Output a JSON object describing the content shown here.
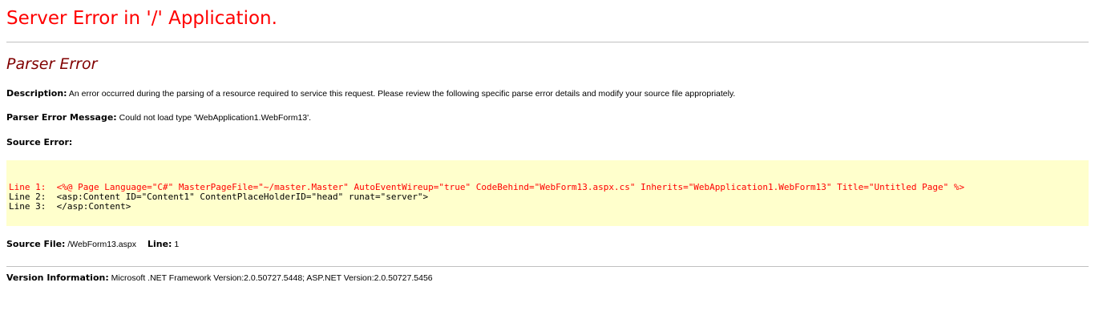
{
  "page": {
    "title": "Server Error in '/' Application.",
    "error_type": "Parser Error"
  },
  "description": {
    "label": "Description:",
    "text": "An error occurred during the parsing of a resource required to service this request. Please review the following specific parse error details and modify your source file appropriately."
  },
  "parser_error_message": {
    "label": "Parser Error Message:",
    "text": "Could not load type 'WebApplication1.WebForm13'."
  },
  "source_error": {
    "label": "Source Error:",
    "lines": [
      {
        "text": "Line 1:  <%@ Page Language=\"C#\" MasterPageFile=\"~/master.Master\" AutoEventWireup=\"true\" CodeBehind=\"WebForm13.aspx.cs\" Inherits=\"WebApplication1.WebForm13\" Title=\"Untitled Page\" %>",
        "highlight": true
      },
      {
        "text": "Line 2:  <asp:Content ID=\"Content1\" ContentPlaceHolderID=\"head\" runat=\"server\">",
        "highlight": false
      },
      {
        "text": "Line 3:  </asp:Content>",
        "highlight": false
      }
    ]
  },
  "source_file": {
    "label": "Source File:",
    "value": "/WebForm13.aspx",
    "line_label": "Line:",
    "line_value": "1"
  },
  "version_information": {
    "label": "Version Information:",
    "text": "Microsoft .NET Framework Version:2.0.50727.5448; ASP.NET Version:2.0.50727.5456"
  },
  "colors": {
    "title": "#ff0000",
    "subtitle": "#800000",
    "code_background": "#ffffcc",
    "error_line": "#ff0000",
    "rule": "#c0c0c0"
  }
}
